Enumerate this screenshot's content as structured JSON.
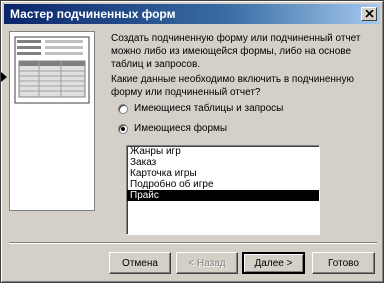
{
  "window": {
    "title": "Мастер подчиненных форм"
  },
  "description": "Создать подчиненную форму или подчиненный отчет можно либо из имеющейся формы, либо на основе таблиц и запросов.",
  "question": "Какие данные необходимо включить в подчиненную форму или подчиненный отчет?",
  "options": [
    {
      "label": "Имеющиеся таблицы и запросы",
      "checked": false
    },
    {
      "label": "Имеющиеся формы",
      "checked": true
    }
  ],
  "forms_list": {
    "items": [
      "Жанры игр",
      "Заказ",
      "Карточка игры",
      "Подробно об игре",
      "Прайс"
    ],
    "selected": "Прайс"
  },
  "buttons": {
    "cancel": "Отмена",
    "back": "< Назад",
    "next": "Далее >",
    "finish": "Готово"
  },
  "colors": {
    "dialog_bg": "#d4d0c8",
    "titlebar_start": "#0a246a",
    "titlebar_end": "#a6caf0",
    "selection": "#000000"
  }
}
